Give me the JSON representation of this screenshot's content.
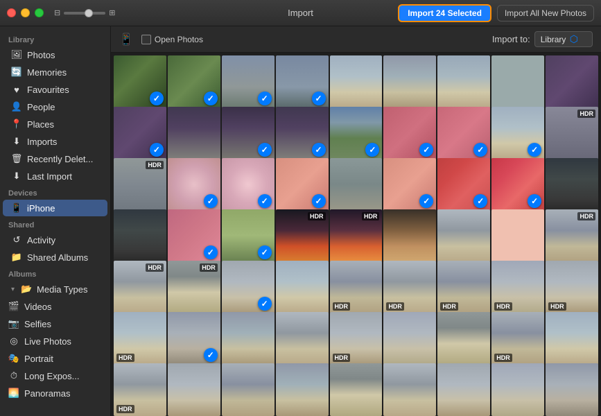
{
  "titlebar": {
    "title": "Import",
    "btn_import_selected": "Import 24 Selected",
    "btn_import_all": "Import All New Photos",
    "slider_min": "⊟",
    "slider_max": "⊞"
  },
  "toolbar": {
    "device_icon": "📱",
    "open_photos_label": "Open Photos",
    "import_to_label": "Import to:",
    "import_to_value": "Library"
  },
  "sidebar": {
    "sections": [
      {
        "header": "Library",
        "items": [
          {
            "id": "photos",
            "label": "Photos",
            "icon": "🖼"
          },
          {
            "id": "memories",
            "label": "Memories",
            "icon": "🔄"
          },
          {
            "id": "favourites",
            "label": "Favourites",
            "icon": "♥"
          },
          {
            "id": "people",
            "label": "People",
            "icon": "👤"
          },
          {
            "id": "places",
            "label": "Places",
            "icon": "📍"
          },
          {
            "id": "imports",
            "label": "Imports",
            "icon": "⬇"
          },
          {
            "id": "recently-deleted",
            "label": "Recently Delet...",
            "icon": "🗑"
          },
          {
            "id": "last-import",
            "label": "Last Import",
            "icon": "⬇"
          }
        ]
      },
      {
        "header": "Devices",
        "items": [
          {
            "id": "iphone",
            "label": "iPhone",
            "icon": "📱",
            "active": true
          }
        ]
      },
      {
        "header": "Shared",
        "items": [
          {
            "id": "activity",
            "label": "Activity",
            "icon": "↺"
          },
          {
            "id": "shared-albums",
            "label": "Shared Albums",
            "icon": "📁"
          }
        ]
      },
      {
        "header": "Albums",
        "items": [
          {
            "id": "media-types",
            "label": "Media Types",
            "icon": "📂",
            "expandable": true,
            "expanded": true
          },
          {
            "id": "videos",
            "label": "Videos",
            "icon": "🎬",
            "sub": true
          },
          {
            "id": "selfies",
            "label": "Selfies",
            "icon": "📷",
            "sub": true
          },
          {
            "id": "live-photos",
            "label": "Live Photos",
            "icon": "◎",
            "sub": true
          },
          {
            "id": "portrait",
            "label": "Portrait",
            "icon": "🎭",
            "sub": true
          },
          {
            "id": "long-exposure",
            "label": "Long Expos...",
            "icon": "⏱",
            "sub": true
          },
          {
            "id": "panoramas",
            "label": "Panoramas",
            "icon": "🌅",
            "sub": true
          }
        ]
      }
    ]
  },
  "photos": [
    {
      "id": 1,
      "color": "p-green-dark",
      "checked": true,
      "hdr": false
    },
    {
      "id": 2,
      "color": "p-green-med",
      "checked": true,
      "hdr": false
    },
    {
      "id": 3,
      "color": "p-grey-sky",
      "checked": true,
      "hdr": false
    },
    {
      "id": 4,
      "color": "p-grey-sky2",
      "checked": true,
      "hdr": false
    },
    {
      "id": 5,
      "color": "p-beach-wide",
      "checked": false,
      "hdr": false
    },
    {
      "id": 6,
      "color": "p-beach-wide2",
      "checked": false,
      "hdr": false
    },
    {
      "id": 7,
      "color": "p-beach3",
      "checked": false,
      "hdr": false
    },
    {
      "id": 8,
      "color": "c7",
      "checked": false,
      "hdr": false
    },
    {
      "id": 9,
      "color": "p-purple-rock",
      "checked": false,
      "hdr": false
    },
    {
      "id": 10,
      "color": "p-purple-rock",
      "checked": true,
      "hdr": false
    },
    {
      "id": 11,
      "color": "p-arch",
      "checked": false,
      "hdr": false
    },
    {
      "id": 12,
      "color": "p-arch2",
      "checked": true,
      "hdr": false
    },
    {
      "id": 13,
      "color": "p-arch",
      "checked": true,
      "hdr": false
    },
    {
      "id": 14,
      "color": "p-green-field",
      "checked": true,
      "hdr": false
    },
    {
      "id": 15,
      "color": "p-pink-wall",
      "checked": true,
      "hdr": false
    },
    {
      "id": 16,
      "color": "p-pink-wall2",
      "checked": true,
      "hdr": false
    },
    {
      "id": 17,
      "color": "p-beach-wide",
      "checked": true,
      "hdr": false
    },
    {
      "id": 18,
      "color": "p-grey-rocks",
      "checked": false,
      "hdr": true,
      "hdr_pos": "top"
    },
    {
      "id": 19,
      "color": "p-grey-cliffs",
      "checked": false,
      "hdr": true,
      "hdr_pos": "top"
    },
    {
      "id": 20,
      "color": "p-pink-petals",
      "checked": true,
      "hdr": false
    },
    {
      "id": 21,
      "color": "p-pink-petals2",
      "checked": true,
      "hdr": false
    },
    {
      "id": 22,
      "color": "p-salmon",
      "checked": true,
      "hdr": false
    },
    {
      "id": 23,
      "color": "p-cliffs-hdr",
      "checked": false,
      "hdr": false
    },
    {
      "id": 24,
      "color": "p-salmon",
      "checked": true,
      "hdr": false
    },
    {
      "id": 25,
      "color": "p-red-texture",
      "checked": true,
      "hdr": false
    },
    {
      "id": 26,
      "color": "p-red-texture2",
      "checked": true,
      "hdr": false
    },
    {
      "id": 27,
      "color": "p-dark-path",
      "checked": false,
      "hdr": false
    },
    {
      "id": 28,
      "color": "p-dark-path",
      "checked": false,
      "hdr": false
    },
    {
      "id": 29,
      "color": "p-pink-door",
      "checked": true,
      "hdr": false
    },
    {
      "id": 30,
      "color": "p-daisy",
      "checked": true,
      "hdr": false
    },
    {
      "id": 31,
      "color": "p-hdr-sunset",
      "checked": false,
      "hdr": true,
      "hdr_pos": "top"
    },
    {
      "id": 32,
      "color": "p-sunset",
      "checked": false,
      "hdr": true,
      "hdr_pos": "top"
    },
    {
      "id": 33,
      "color": "p-orange-sunset",
      "checked": false,
      "hdr": false
    },
    {
      "id": 34,
      "color": "p-flat-sand",
      "checked": false,
      "hdr": false
    },
    {
      "id": 35,
      "color": "c35",
      "checked": false,
      "hdr": false
    },
    {
      "id": 36,
      "color": "p-flat-sand2",
      "checked": false,
      "hdr": true,
      "hdr_pos": "top"
    },
    {
      "id": 37,
      "color": "p-flat-sand",
      "checked": false,
      "hdr": true,
      "hdr_pos": "top"
    },
    {
      "id": 38,
      "color": "p-moody-sand",
      "checked": false,
      "hdr": true,
      "hdr_pos": "top"
    },
    {
      "id": 39,
      "color": "p-winter-beach",
      "checked": true,
      "hdr": false
    },
    {
      "id": 40,
      "color": "p-beach-wide",
      "checked": false,
      "hdr": false
    },
    {
      "id": 41,
      "color": "p-flat-sand2",
      "checked": false,
      "hdr": true,
      "hdr_pos": "bottom"
    },
    {
      "id": 42,
      "color": "p-flat-sand",
      "checked": false,
      "hdr": true,
      "hdr_pos": "bottom"
    },
    {
      "id": 43,
      "color": "p-flat-sand2",
      "checked": false,
      "hdr": true,
      "hdr_pos": "bottom"
    },
    {
      "id": 44,
      "color": "p-sand-people",
      "checked": false,
      "hdr": true,
      "hdr_pos": "bottom"
    },
    {
      "id": 45,
      "color": "p-winter-beach",
      "checked": false,
      "hdr": true,
      "hdr_pos": "bottom"
    },
    {
      "id": 46,
      "color": "p-beach-wide",
      "checked": false,
      "hdr": true,
      "hdr_pos": "bottom"
    },
    {
      "id": 47,
      "color": "p-beach-hdr",
      "checked": true,
      "hdr": false
    },
    {
      "id": 48,
      "color": "p-beach-wide2",
      "checked": false,
      "hdr": false
    },
    {
      "id": 49,
      "color": "p-flat-sand",
      "checked": false,
      "hdr": false
    },
    {
      "id": 50,
      "color": "p-winter-beach",
      "checked": false,
      "hdr": true,
      "hdr_pos": "bottom"
    },
    {
      "id": 51,
      "color": "p-sand-people",
      "checked": false,
      "hdr": false
    },
    {
      "id": 52,
      "color": "p-moody-sand",
      "checked": false,
      "hdr": false
    },
    {
      "id": 53,
      "color": "p-flat-sand2",
      "checked": false,
      "hdr": true,
      "hdr_pos": "bottom"
    },
    {
      "id": 54,
      "color": "p-beach-wide",
      "checked": false,
      "hdr": false
    },
    {
      "id": 55,
      "color": "p-flat-sand",
      "checked": false,
      "hdr": true,
      "hdr_pos": "bottom"
    },
    {
      "id": 56,
      "color": "p-winter-beach",
      "checked": false,
      "hdr": false
    },
    {
      "id": 57,
      "color": "p-flat-sand2",
      "checked": false,
      "hdr": false
    },
    {
      "id": 58,
      "color": "p-beach-wide2",
      "checked": false,
      "hdr": false
    },
    {
      "id": 59,
      "color": "p-moody-sand",
      "checked": false,
      "hdr": false
    },
    {
      "id": 60,
      "color": "p-flat-sand",
      "checked": false,
      "hdr": false
    },
    {
      "id": 61,
      "color": "p-winter-beach",
      "checked": false,
      "hdr": false
    },
    {
      "id": 62,
      "color": "p-sand-people",
      "checked": false,
      "hdr": false
    },
    {
      "id": 63,
      "color": "p-beach-hdr",
      "checked": false,
      "hdr": false
    }
  ]
}
